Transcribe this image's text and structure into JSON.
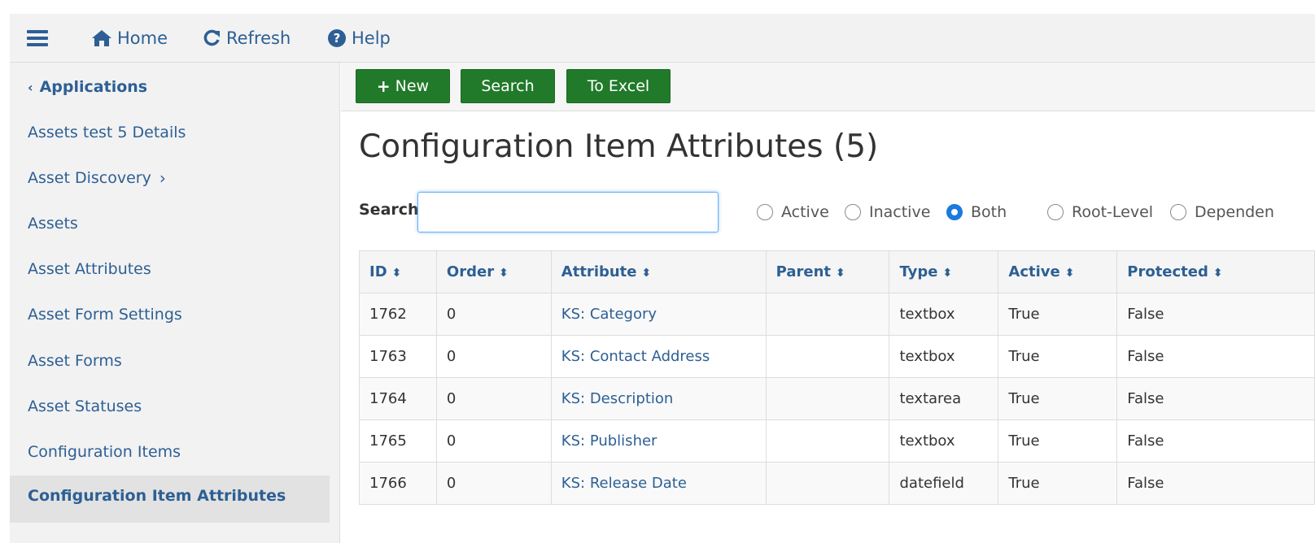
{
  "topbar": {
    "home_label": "Home",
    "refresh_label": "Refresh",
    "help_label": "Help"
  },
  "sidebar": {
    "back_label": "Applications",
    "items": [
      {
        "label": "Assets test 5 Details"
      },
      {
        "label": "Asset Discovery"
      },
      {
        "label": "Assets"
      },
      {
        "label": "Asset Attributes"
      },
      {
        "label": "Asset Form Settings"
      },
      {
        "label": "Asset Forms"
      },
      {
        "label": "Asset Statuses"
      },
      {
        "label": "Configuration Items"
      }
    ],
    "active_label": "Configuration Item Attributes"
  },
  "toolbar": {
    "new_label": "New",
    "search_label": "Search",
    "excel_label": "To Excel"
  },
  "page": {
    "title": "Configuration Item Attributes (5)"
  },
  "search": {
    "label": "Search",
    "value": "",
    "placeholder": ""
  },
  "filters": {
    "status": [
      {
        "label": "Active",
        "selected": false
      },
      {
        "label": "Inactive",
        "selected": false
      },
      {
        "label": "Both",
        "selected": true
      }
    ],
    "level": [
      {
        "label": "Root-Level",
        "selected": false
      },
      {
        "label": "Dependen",
        "selected": false
      }
    ]
  },
  "table": {
    "columns": [
      "ID",
      "Order",
      "Attribute",
      "Parent",
      "Type",
      "Active",
      "Protected"
    ],
    "rows": [
      {
        "id": "1762",
        "order": "0",
        "attribute": "KS: Category",
        "parent": "",
        "type": "textbox",
        "active": "True",
        "protected": "False"
      },
      {
        "id": "1763",
        "order": "0",
        "attribute": "KS: Contact Address",
        "parent": "",
        "type": "textbox",
        "active": "True",
        "protected": "False"
      },
      {
        "id": "1764",
        "order": "0",
        "attribute": "KS: Description",
        "parent": "",
        "type": "textarea",
        "active": "True",
        "protected": "False"
      },
      {
        "id": "1765",
        "order": "0",
        "attribute": "KS: Publisher",
        "parent": "",
        "type": "textbox",
        "active": "True",
        "protected": "False"
      },
      {
        "id": "1766",
        "order": "0",
        "attribute": "KS: Release Date",
        "parent": "",
        "type": "datefield",
        "active": "True",
        "protected": "False"
      }
    ]
  },
  "colors": {
    "accent": "#2d5f94",
    "button": "#217a2a",
    "radio_on": "#1a7ae0"
  }
}
